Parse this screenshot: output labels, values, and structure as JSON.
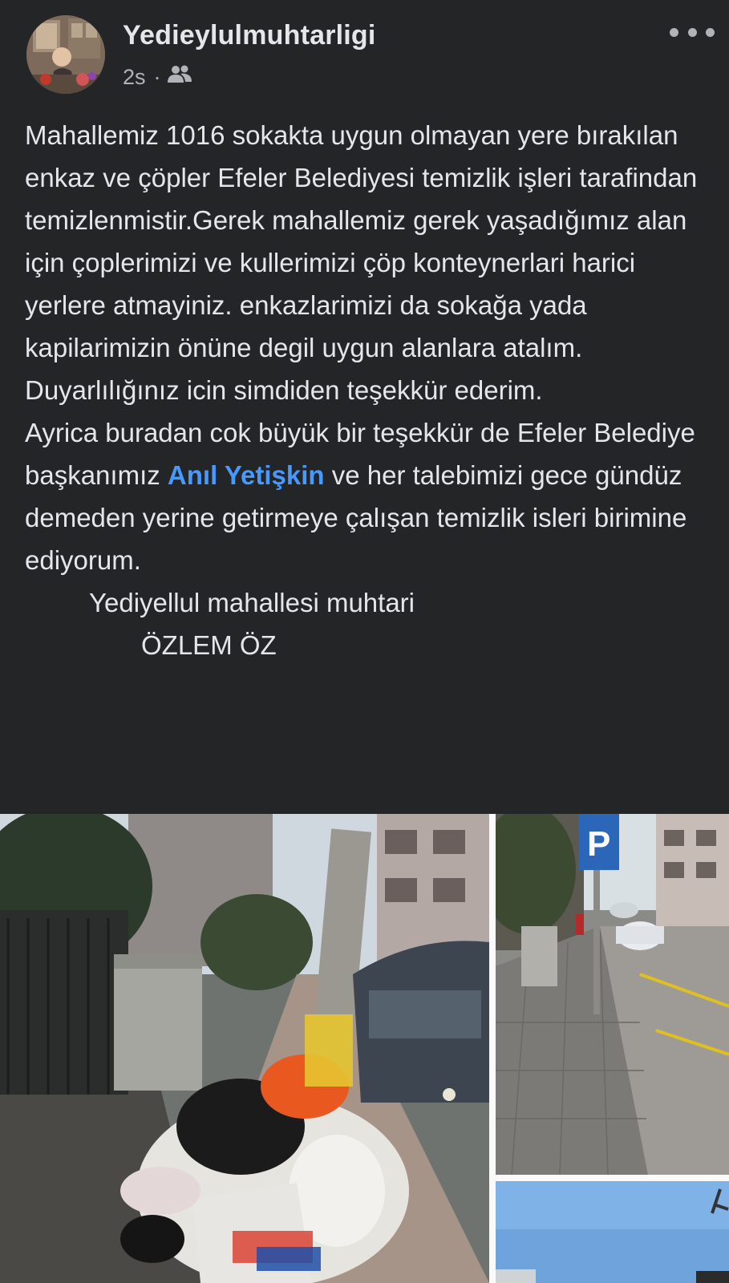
{
  "post": {
    "author": "Yedieylulmuhtarligi",
    "time": "2s",
    "separator": "·",
    "audience_icon": "friends-icon",
    "more_icon": "more-horizontal-icon",
    "paragraphs": [
      "Mahallemiz 1016 sokakta uygun olmayan yere bırakılan enkaz ve çöpler Efeler Belediyesi temizlik işleri tarafindan temizlenmistir.Gerek mahallemiz gerek yaşadığımız alan için çoplerimizi ve kullerimizi çöp konteynerlari harici yerlere atmayiniz. enkazlarimizi da sokağa yada kapilarimizin önüne degil uygun alanlara atalım. Duyarlılığınız icin simdiden teşekkür ederim."
    ],
    "thanks_before": "Ayrica buradan cok büyük bir teşekkür de Efeler Belediye başkanımız ",
    "mention": "Anıl Yetişkin",
    "thanks_after": " ve her talebimizi gece gündüz demeden yerine getirmeye çalışan temizlik isleri birimine ediyorum.",
    "signature_line1": "Yediyellul mahallesi muhtari",
    "signature_line2": "ÖZLEM ÖZ"
  },
  "colors": {
    "background": "#242526",
    "text": "#e4e6eb",
    "secondary_text": "#b0b3b8",
    "mention": "#4599ff"
  },
  "photos": [
    {
      "name": "garbage-pile-photo"
    },
    {
      "name": "clean-sidewalk-photo"
    },
    {
      "name": "sky-photo"
    }
  ]
}
